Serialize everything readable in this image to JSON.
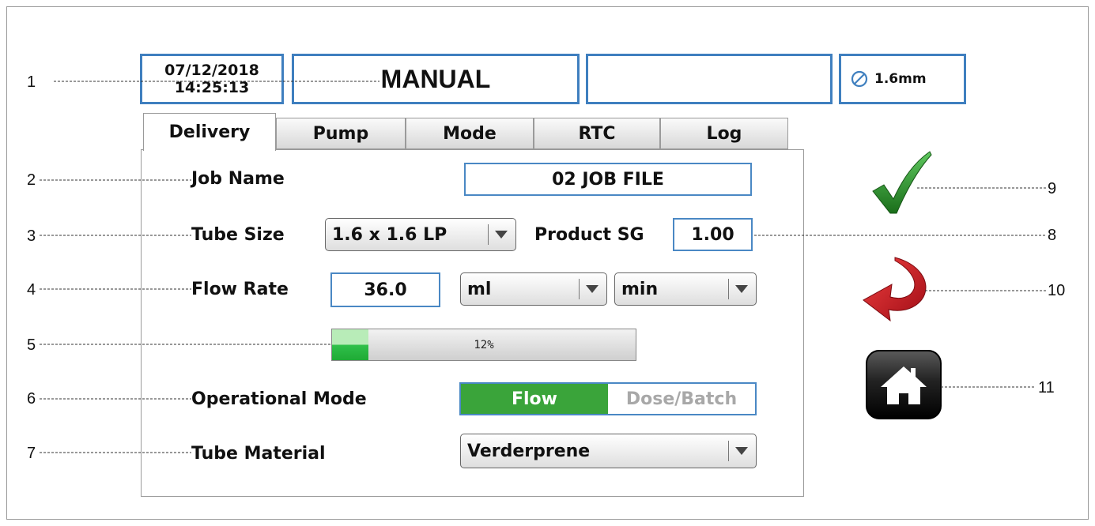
{
  "header": {
    "date": "07/12/2018",
    "time": "14:25:13",
    "mode": "MANUAL",
    "status": "",
    "tube_size": "1.6mm"
  },
  "tabs": [
    "Delivery",
    "Pump",
    "Mode",
    "RTC",
    "Log"
  ],
  "form": {
    "job_name_label": "Job Name",
    "job_name_value": "02 JOB FILE",
    "tube_size_label": "Tube Size",
    "tube_size_value": "1.6 x 1.6 LP",
    "product_sg_label": "Product SG",
    "product_sg_value": "1.00",
    "flow_rate_label": "Flow Rate",
    "flow_rate_value": "36.0",
    "flow_unit": "ml",
    "flow_time_unit": "min",
    "progress_text": "12%",
    "progress_fraction": 0.12,
    "operational_mode_label": "Operational Mode",
    "mode_flow": "Flow",
    "mode_dose": "Dose/Batch",
    "tube_material_label": "Tube Material",
    "tube_material_value": "Verderprene"
  },
  "callouts": [
    "1",
    "2",
    "3",
    "4",
    "5",
    "6",
    "7",
    "8",
    "9",
    "10",
    "11"
  ],
  "icons": {
    "confirm": "checkmark-icon",
    "back": "back-arrow-icon",
    "home": "home-icon",
    "tube": "diameter-icon"
  },
  "colors": {
    "accent_blue": "#3f7fbf",
    "flow_green": "#3aa43a",
    "check_green": "#2e8b2e",
    "arrow_red": "#c8141e"
  }
}
